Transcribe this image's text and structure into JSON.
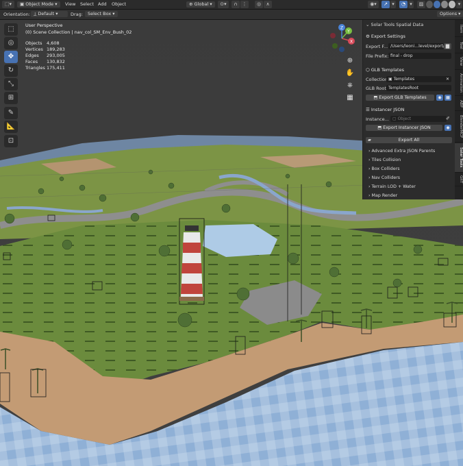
{
  "header": {
    "mode": "Object Mode",
    "menus": [
      "View",
      "Select",
      "Add",
      "Object"
    ],
    "transform_orientation": "Global",
    "options_label": "Options"
  },
  "tool_header": {
    "orientation_label": "Orientation:",
    "orientation_value": "Default",
    "drag_label": "Drag:",
    "drag_value": "Select Box"
  },
  "viewport": {
    "title": "User Perspective",
    "collection": "(0) Scene Collection | nav_col_SM_Env_Bush_02",
    "stats": [
      {
        "label": "Objects",
        "value": "4,608"
      },
      {
        "label": "Vertices",
        "value": "189,283"
      },
      {
        "label": "Edges",
        "value": "293,005"
      },
      {
        "label": "Faces",
        "value": "130,832"
      },
      {
        "label": "Triangles",
        "value": "175,411"
      }
    ],
    "gizmo_axes": [
      "X",
      "Y",
      "Z"
    ]
  },
  "panel": {
    "title": "Solar Tools Spatial Data",
    "export_settings": {
      "header": "Export Settings",
      "export_folder_label": "Export F...",
      "export_folder_value": "/Users/leoni...level/export/",
      "file_prefix_label": "File Prefix:",
      "file_prefix_value": "final - drop"
    },
    "glb_templates": {
      "header": "GLB Templates",
      "collection_label": "Collection:",
      "collection_value": "Templates",
      "root_label": "GLB Root...",
      "root_value": "TemplatesRoot",
      "export_button": "Export GLB Templates"
    },
    "instancer_json": {
      "header": "Instancer JSON",
      "instance_label": "Instance...",
      "instance_placeholder": "Object",
      "export_button": "Export Instancer JSON"
    },
    "export_all": "Export All",
    "subpanels": [
      "Advanced Extra JSON Parents",
      "Tiles Collision",
      "Box Colliders",
      "Nav Colliders",
      "Terrain LOD + Water",
      "Map Render"
    ]
  },
  "side_tabs": [
    "Item",
    "Tool",
    "View",
    "Animation",
    "ABP",
    "BlenderMCP",
    "Solar Tools",
    "GitT"
  ],
  "active_tab": "Solar Tools",
  "colors": {
    "accent": "#4772b3",
    "panel_bg": "#2c2c2c",
    "header_bg": "#2b2b2b",
    "grass": "#6a8a3c",
    "sand": "#c49a72",
    "water": "#9cb8d8"
  }
}
